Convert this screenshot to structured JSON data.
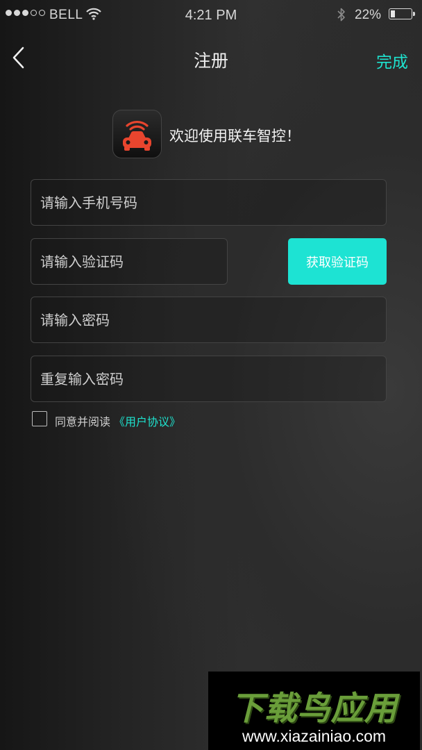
{
  "status_bar": {
    "carrier": "BELL",
    "time": "4:21 PM",
    "battery_percent": "22%",
    "battery_level": 0.22,
    "signal_bars_filled": 3,
    "signal_bars_total": 5,
    "icons": [
      "wifi-icon",
      "bluetooth-icon",
      "battery-icon"
    ]
  },
  "nav": {
    "title": "注册",
    "done_label": "完成",
    "back_icon": "chevron-left-icon"
  },
  "welcome": {
    "text": "欢迎使用联车智控！",
    "app_icon": "car-signal-icon"
  },
  "form": {
    "phone_placeholder": "请输入手机号码",
    "phone_value": "",
    "code_placeholder": "请输入验证码",
    "code_value": "",
    "get_code_label": "获取验证码",
    "password_placeholder": "请输入密码",
    "password_value": "",
    "confirm_placeholder": "重复输入密码",
    "confirm_value": ""
  },
  "agreement": {
    "checked": false,
    "text": "同意并阅读",
    "link": "《用户协议》"
  },
  "watermark": {
    "title": "下载鸟应用",
    "url": "www.xiazainiao.com"
  },
  "colors": {
    "accent": "#1ee3cf",
    "button": "#1de3d3",
    "icon_red": "#e8452e",
    "watermark_green": "#6a9e3a"
  }
}
